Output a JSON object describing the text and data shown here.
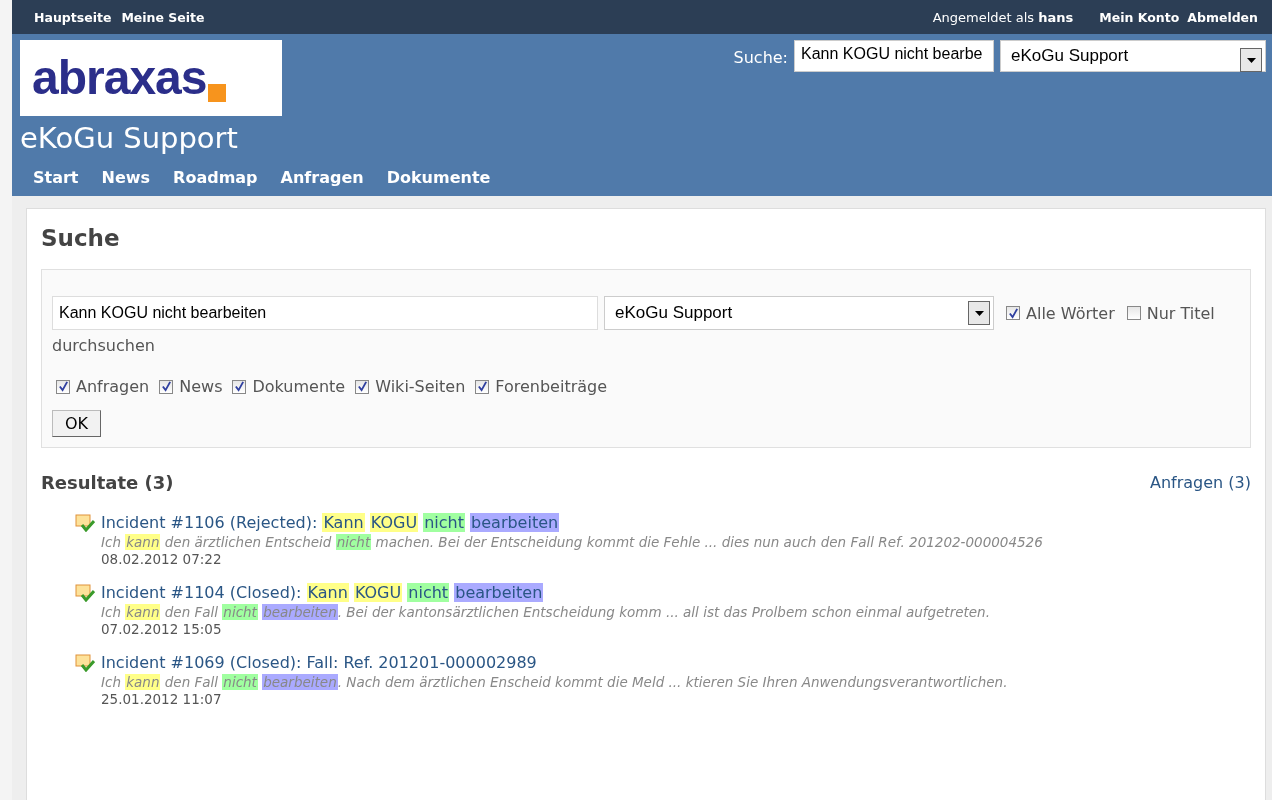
{
  "top_bar": {
    "left_links": [
      "Hauptseite",
      "Meine Seite"
    ],
    "logged_in_label": "Angemeldet als",
    "user": "hans",
    "right_links": [
      "Mein Konto",
      "Abmelden"
    ]
  },
  "header": {
    "logo_text": "abraxas",
    "project_title": "eKoGu Support",
    "search_label": "Suche:",
    "search_value": "Kann KOGU nicht bearbe",
    "project_select": "eKoGu Support",
    "menu": [
      "Start",
      "News",
      "Roadmap",
      "Anfragen",
      "Dokumente"
    ]
  },
  "page_title": "Suche",
  "search_form": {
    "query": "Kann KOGU nicht bearbeiten",
    "scope": "eKoGu Support",
    "options": [
      {
        "label": "Alle Wörter",
        "checked": true
      },
      {
        "label": "Nur Titel",
        "checked": false
      }
    ],
    "options_tail": "durchsuchen",
    "types": [
      {
        "label": "Anfragen",
        "checked": true
      },
      {
        "label": "News",
        "checked": true
      },
      {
        "label": "Dokumente",
        "checked": true
      },
      {
        "label": "Wiki-Seiten",
        "checked": true
      },
      {
        "label": "Forenbeiträge",
        "checked": true
      }
    ],
    "submit": "OK"
  },
  "results_title": "Resultate (3)",
  "results_filter": "Anfragen (3)",
  "results": [
    {
      "title": [
        {
          "text": "Incident #1106 (Rejected): "
        },
        {
          "text": "Kann",
          "color": "#ffff88",
          "space_after": true
        },
        {
          "text": "KOGU",
          "color": "#ffff88",
          "space_after": true
        },
        {
          "text": "nicht",
          "color": "#a0ffa0",
          "space_after": true
        },
        {
          "text": "bearbeiten",
          "color": "#aaaaff"
        }
      ],
      "excerpt": [
        {
          "text": "Ich "
        },
        {
          "text": "kann",
          "color": "#ffff88"
        },
        {
          "text": " den ärztlichen Entscheid "
        },
        {
          "text": "nicht",
          "color": "#a0ffa0"
        },
        {
          "text": " machen. Bei der Entscheidung kommt die Fehle ... dies nun auch den Fall Ref. 201202-000004526"
        }
      ],
      "date": "08.02.2012 07:22"
    },
    {
      "title": [
        {
          "text": "Incident #1104 (Closed): "
        },
        {
          "text": "Kann",
          "color": "#ffff88",
          "space_after": true
        },
        {
          "text": "KOGU",
          "color": "#ffff88",
          "space_after": true
        },
        {
          "text": "nicht",
          "color": "#a0ffa0",
          "space_after": true
        },
        {
          "text": "bearbeiten",
          "color": "#aaaaff"
        }
      ],
      "excerpt": [
        {
          "text": "Ich "
        },
        {
          "text": "kann",
          "color": "#ffff88"
        },
        {
          "text": " den Fall "
        },
        {
          "text": "nicht",
          "color": "#a0ffa0",
          "space_after": true
        },
        {
          "text": "bearbeiten",
          "color": "#aaaaff"
        },
        {
          "text": ". Bei der kantonsärztlichen Entscheidung komm ... all ist das Prolbem schon einmal aufgetreten."
        }
      ],
      "date": "07.02.2012 15:05"
    },
    {
      "title": [
        {
          "text": "Incident #1069 (Closed): Fall: Ref. 201201-000002989"
        }
      ],
      "excerpt": [
        {
          "text": "Ich "
        },
        {
          "text": "kann",
          "color": "#ffff88"
        },
        {
          "text": " den Fall "
        },
        {
          "text": "nicht",
          "color": "#a0ffa0",
          "space_after": true
        },
        {
          "text": "bearbeiten",
          "color": "#aaaaff"
        },
        {
          "text": ". Nach dem ärztlichen Enscheid kommt die Meld ... ktieren Sie Ihren Anwendungsverantwortlichen."
        }
      ],
      "date": "25.01.2012 11:07"
    }
  ]
}
